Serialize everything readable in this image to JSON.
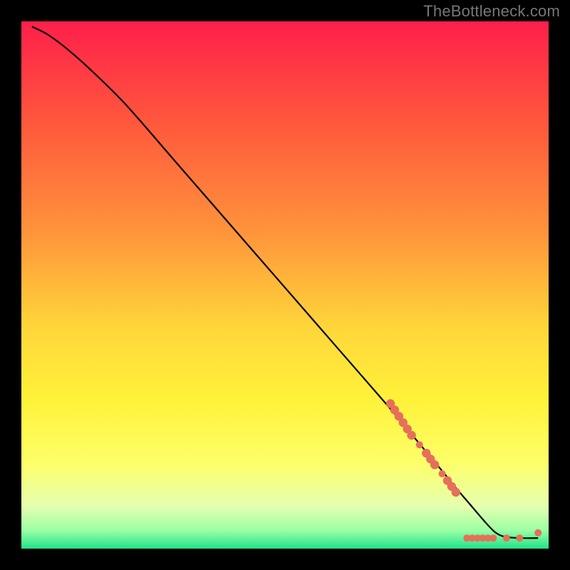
{
  "watermark": "TheBottleneck.com",
  "chart_data": {
    "type": "line",
    "title": "",
    "xlabel": "",
    "ylabel": "",
    "xlim": [
      0,
      100
    ],
    "ylim": [
      0,
      100
    ],
    "grid": false,
    "legend": false,
    "gradient_stops": [
      {
        "offset": 0.0,
        "color": "#ff1f4b"
      },
      {
        "offset": 0.2,
        "color": "#ff5a3c"
      },
      {
        "offset": 0.4,
        "color": "#ff943b"
      },
      {
        "offset": 0.58,
        "color": "#ffd63a"
      },
      {
        "offset": 0.72,
        "color": "#fff23a"
      },
      {
        "offset": 0.84,
        "color": "#fdff6b"
      },
      {
        "offset": 0.92,
        "color": "#e5ffb0"
      },
      {
        "offset": 0.965,
        "color": "#9cffa4"
      },
      {
        "offset": 1.0,
        "color": "#20e38a"
      }
    ],
    "series": [
      {
        "name": "curve",
        "color": "#000000",
        "x": [
          2,
          5,
          9,
          14,
          20,
          30,
          40,
          50,
          60,
          70,
          75,
          80,
          82,
          85,
          88,
          90,
          92,
          95,
          98
        ],
        "y": [
          99,
          97.5,
          94.5,
          90,
          84,
          72.5,
          61,
          49.5,
          38,
          26.5,
          20.5,
          14.5,
          12,
          8.5,
          5,
          3,
          2.2,
          2,
          2
        ]
      }
    ],
    "markers": {
      "name": "dots",
      "color": "#e5705a",
      "radius_large": 6.2,
      "radius_small": 5.0,
      "points": [
        {
          "x": 70.0,
          "y": 27.5,
          "r": "large"
        },
        {
          "x": 70.8,
          "y": 26.3,
          "r": "large"
        },
        {
          "x": 71.6,
          "y": 25.1,
          "r": "large"
        },
        {
          "x": 72.4,
          "y": 23.9,
          "r": "large"
        },
        {
          "x": 73.2,
          "y": 22.7,
          "r": "large"
        },
        {
          "x": 74.0,
          "y": 21.5,
          "r": "large"
        },
        {
          "x": 75.5,
          "y": 19.7,
          "r": "small"
        },
        {
          "x": 76.8,
          "y": 18.1,
          "r": "large"
        },
        {
          "x": 77.6,
          "y": 17.0,
          "r": "large"
        },
        {
          "x": 78.4,
          "y": 15.9,
          "r": "large"
        },
        {
          "x": 79.8,
          "y": 14.2,
          "r": "small"
        },
        {
          "x": 80.8,
          "y": 12.9,
          "r": "large"
        },
        {
          "x": 81.6,
          "y": 11.8,
          "r": "large"
        },
        {
          "x": 82.4,
          "y": 10.7,
          "r": "large"
        },
        {
          "x": 84.5,
          "y": 2.0,
          "r": "small"
        },
        {
          "x": 85.5,
          "y": 2.0,
          "r": "small"
        },
        {
          "x": 86.5,
          "y": 2.0,
          "r": "small"
        },
        {
          "x": 87.5,
          "y": 2.0,
          "r": "small"
        },
        {
          "x": 88.5,
          "y": 2.0,
          "r": "small"
        },
        {
          "x": 89.5,
          "y": 2.0,
          "r": "small"
        },
        {
          "x": 92.0,
          "y": 2.0,
          "r": "small"
        },
        {
          "x": 94.5,
          "y": 2.0,
          "r": "small"
        },
        {
          "x": 98.0,
          "y": 3.0,
          "r": "small"
        }
      ]
    }
  }
}
